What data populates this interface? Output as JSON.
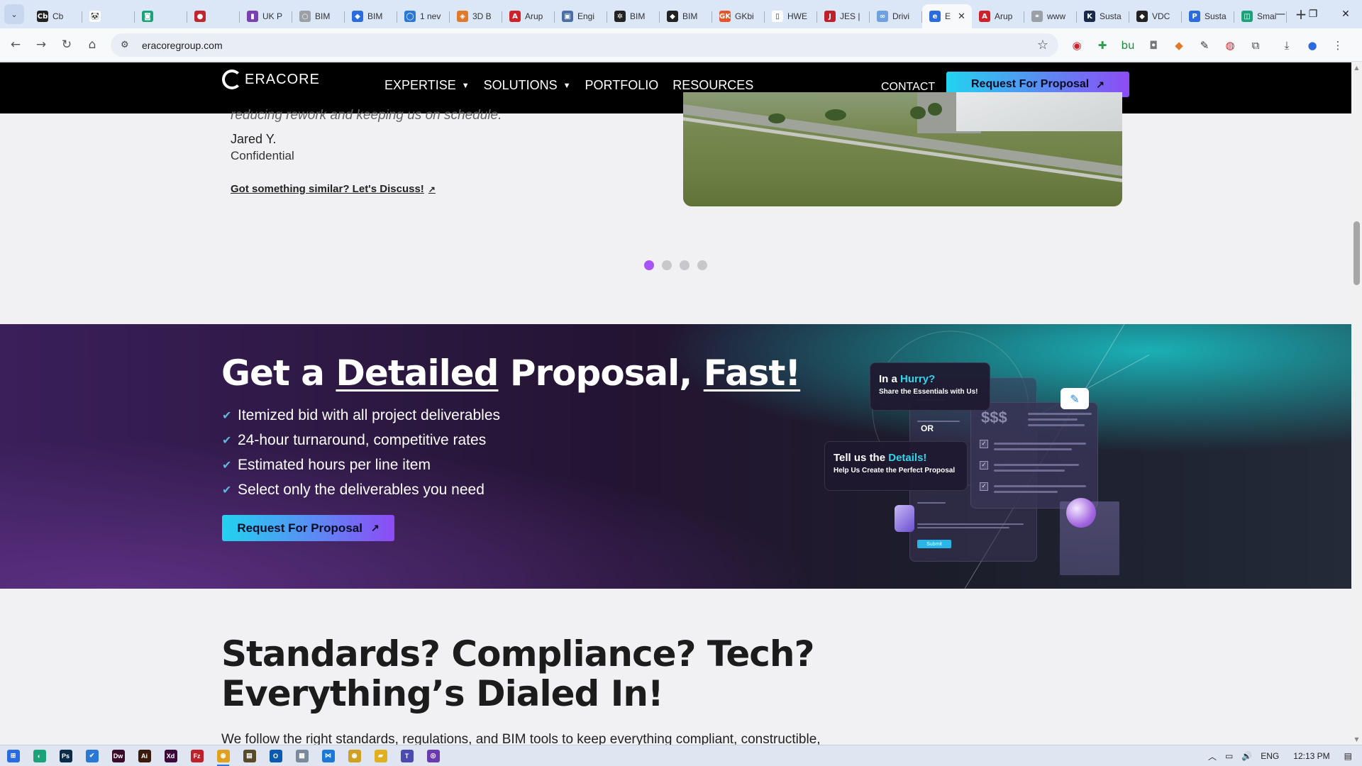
{
  "browser": {
    "tabs": [
      {
        "label": "Cb",
        "fav": "Cb",
        "color": "#222222"
      },
      {
        "label": "",
        "fav": "🐼",
        "color": "#ffffff"
      },
      {
        "label": "",
        "fav": "◙",
        "color": "#1aa37a"
      },
      {
        "label": "",
        "fav": "●",
        "color": "#c0262d"
      },
      {
        "label": "UK P",
        "fav": "▮",
        "color": "#7a3fb0"
      },
      {
        "label": "BIM",
        "fav": "○",
        "color": "#9aa0a6"
      },
      {
        "label": "BIM",
        "fav": "◆",
        "color": "#2a6be0"
      },
      {
        "label": "1 nev",
        "fav": "◯",
        "color": "#2a78d6"
      },
      {
        "label": "3D B",
        "fav": "◈",
        "color": "#e07a2a"
      },
      {
        "label": "Arup",
        "fav": "A",
        "color": "#d0202a"
      },
      {
        "label": "Engi",
        "fav": "▣",
        "color": "#4a6fa5"
      },
      {
        "label": "BIM",
        "fav": "✲",
        "color": "#222222"
      },
      {
        "label": "BIM",
        "fav": "◆",
        "color": "#222222"
      },
      {
        "label": "GKbi",
        "fav": "GK",
        "color": "#e8542a"
      },
      {
        "label": "HWE",
        "fav": "▯",
        "color": "#ffffff"
      },
      {
        "label": "JES |",
        "fav": "J",
        "color": "#c0202a"
      },
      {
        "label": "Drivi",
        "fav": "∞",
        "color": "#6fa0e0"
      },
      {
        "label": "E",
        "fav": "e",
        "color": "#2a6be0",
        "active": true
      },
      {
        "label": "Arup",
        "fav": "A",
        "color": "#d0202a"
      },
      {
        "label": "www",
        "fav": "⚭",
        "color": "#9aa0a6"
      },
      {
        "label": "Susta",
        "fav": "K",
        "color": "#1a2a4a"
      },
      {
        "label": "VDC",
        "fav": "◆",
        "color": "#222222"
      },
      {
        "label": "Susta",
        "fav": "P",
        "color": "#2a6be0"
      },
      {
        "label": "Smai",
        "fav": "◫",
        "color": "#1aa37a"
      }
    ],
    "url": "eracoregroup.com"
  },
  "site": {
    "brand": "ERACORE",
    "menu": [
      "EXPERTISE",
      "SOLUTIONS",
      "PORTFOLIO",
      "RESOURCES"
    ],
    "contact": "CONTACT",
    "cta": "Request For Proposal"
  },
  "testimonial": {
    "quote_tail": "reducing rework and keeping us on schedule.",
    "author": "Jared Y.",
    "company": "Confidential",
    "discuss": "Got something similar? Let's Discuss!"
  },
  "promo": {
    "title_parts": [
      "Get a ",
      "Detailed",
      " Proposal, ",
      "Fast!"
    ],
    "bullets": [
      "Itemized bid with all project deliverables",
      "24-hour turnaround, competitive rates",
      "Estimated hours per line item",
      "Select only the deliverables you need"
    ],
    "cta": "Request For Proposal",
    "mock": {
      "hurry_a": "In a ",
      "hurry_b": "Hurry?",
      "hurry_sub": "Share the Essentials with Us!",
      "or": "OR",
      "price": "$$$",
      "details_a": "Tell us the ",
      "details_b": "Details!",
      "details_sub": "Help Us Create the Perfect Proposal",
      "submit": "Submit"
    }
  },
  "standards": {
    "title_line1": "Standards? Compliance? Tech?",
    "title_line2": "Everything’s Dialed In!",
    "body": "We follow the right standards, regulations, and BIM tools to keep everything compliant, constructible,"
  },
  "taskbar": {
    "apps": [
      {
        "fav": "⊞",
        "color": "#2a6be0"
      },
      {
        "fav": "◐",
        "color": "#1aa37a"
      },
      {
        "fav": "Ps",
        "color": "#0a2a4a"
      },
      {
        "fav": "✔",
        "color": "#2a78d6"
      },
      {
        "fav": "Dw",
        "color": "#3a0a2a"
      },
      {
        "fav": "Ai",
        "color": "#3a1a0a"
      },
      {
        "fav": "Xd",
        "color": "#3a0a3a"
      },
      {
        "fav": "Fz",
        "color": "#c0202a"
      },
      {
        "fav": "◉",
        "color": "#e0a020",
        "active": true
      },
      {
        "fav": "▤",
        "color": "#5a4a2a"
      },
      {
        "fav": "O",
        "color": "#0a5ab0"
      },
      {
        "fav": "▦",
        "color": "#7a8a9a"
      },
      {
        "fav": "⋈",
        "color": "#1a78d6"
      },
      {
        "fav": "◉",
        "color": "#d0a020"
      },
      {
        "fav": "▰",
        "color": "#e0b020"
      },
      {
        "fav": "T",
        "color": "#4a4ab0"
      },
      {
        "fav": "◎",
        "color": "#6a3ab0"
      }
    ],
    "lang": "ENG",
    "time": "12:13 PM"
  }
}
